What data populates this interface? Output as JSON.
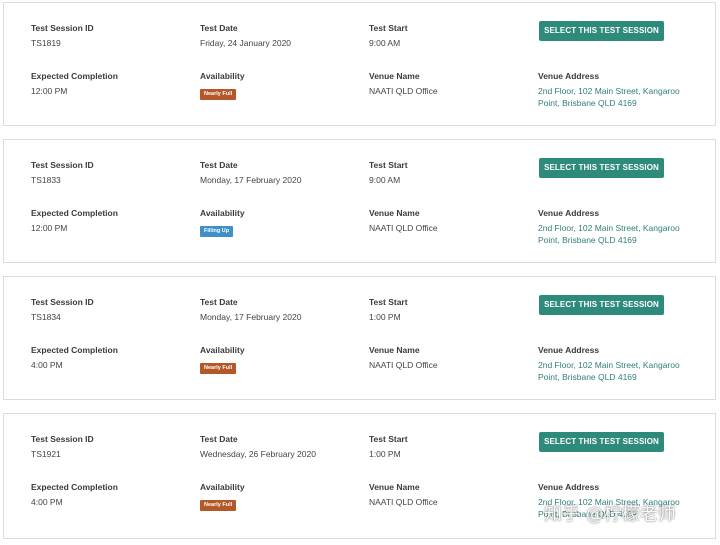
{
  "labels": {
    "session_id": "Test Session ID",
    "date": "Test Date",
    "start": "Test Start",
    "select_button": "SELECT THIS TEST SESSION",
    "completion": "Expected Completion",
    "availability": "Availability",
    "venue_name": "Venue Name",
    "venue_address": "Venue Address"
  },
  "colors": {
    "button": "#2e8b7c",
    "address_link": "#2f7f7a",
    "nearly_full": "#b4582a",
    "filling_up": "#3f8fc9"
  },
  "sessions": [
    {
      "id": "TS1819",
      "date": "Friday, 24 January 2020",
      "start": "9:00 AM",
      "completion": "12:00 PM",
      "availability": "Nearly Full",
      "availability_color": "#b4582a",
      "venue_name": "NAATI QLD Office",
      "venue_address": "2nd Floor, 102 Main Street, Kangaroo Point, Brisbane QLD 4169"
    },
    {
      "id": "TS1833",
      "date": "Monday, 17 February 2020",
      "start": "9:00 AM",
      "completion": "12:00 PM",
      "availability": "Filling Up",
      "availability_color": "#3f8fc9",
      "venue_name": "NAATI QLD Office",
      "venue_address": "2nd Floor, 102 Main Street, Kangaroo Point, Brisbane QLD 4169"
    },
    {
      "id": "TS1834",
      "date": "Monday, 17 February 2020",
      "start": "1:00 PM",
      "completion": "4:00 PM",
      "availability": "Nearly Full",
      "availability_color": "#b4582a",
      "venue_name": "NAATI QLD Office",
      "venue_address": "2nd Floor, 102 Main Street, Kangaroo Point, Brisbane QLD 4169"
    },
    {
      "id": "TS1921",
      "date": "Wednesday, 26 February 2020",
      "start": "1:00 PM",
      "completion": "4:00 PM",
      "availability": "Nearly Full",
      "availability_color": "#b4582a",
      "venue_name": "NAATI QLD Office",
      "venue_address": "2nd Floor, 102 Main Street, Kangaroo Point, Brisbane QLD 4169"
    }
  ],
  "watermark": "知乎 @柠檬老师"
}
